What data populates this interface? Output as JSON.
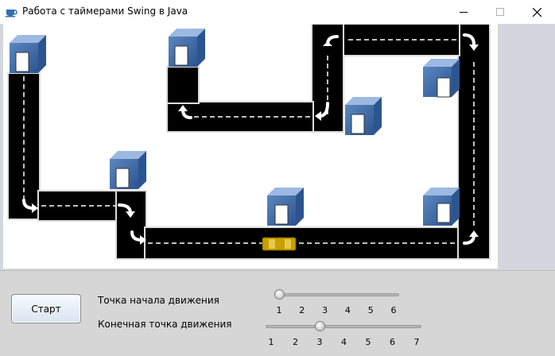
{
  "window": {
    "title": "Работа с таймерами Swing в Java",
    "icon": "java-cup-icon",
    "controls": [
      "minimize-icon",
      "maximize-icon",
      "close-icon"
    ]
  },
  "scene": {
    "road_color": "#000000",
    "lane_marking_color": "#ffffff",
    "building_color": "#5b86c0",
    "car_color": "#c8a000",
    "building_count": 8,
    "car_count": 1
  },
  "controls": {
    "start_button": "Старт",
    "start_label": "Точка начала движения",
    "end_label": "Конечная точка движения",
    "start_slider": {
      "ticks": [
        "1",
        "2",
        "3",
        "4",
        "5",
        "6"
      ],
      "selected": 1
    },
    "end_slider": {
      "ticks": [
        "1",
        "2",
        "3",
        "4",
        "5",
        "6",
        "7"
      ],
      "selected": 3
    }
  }
}
